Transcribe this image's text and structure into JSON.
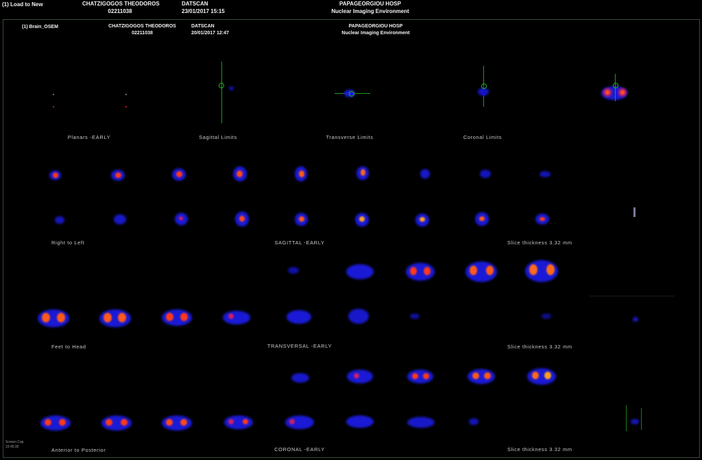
{
  "top_header": {
    "load_button": "(1) Load to New",
    "patient_name": "CHATZIGOGOS THEODOROS",
    "patient_id": "02211038",
    "study": "DATSCAN",
    "datetime": "23/01/2017 15:15",
    "hospital": "PAPAGEORGIOU HOSP",
    "environment": "Nuclear Imaging Environment"
  },
  "series_header": {
    "series_name": "(1) Brain_OSEM",
    "patient_name": "CHATZIGOGOS THEODOROS",
    "patient_id": "02211038",
    "study": "DATSCAN",
    "datetime": "20/01/2017 12:47",
    "hospital": "PAPAGEORGIOU HOSP",
    "environment": "Nuclear Imaging Environment"
  },
  "labels": {
    "planars": "Planars -EARLY",
    "sagittal_limits": "Sagittal Limits",
    "transverse_limits": "Transverse Limits",
    "coronal_limits": "Coronal Limits",
    "right_to_left": "Right to Left",
    "sagittal_early": "SAGITTAL -EARLY",
    "slice_thickness_1": "Slice thickness 3.32 mm",
    "feet_to_head": "Feet to Head",
    "transversal_early": "TRANSVERSAL -EARLY",
    "slice_thickness_2": "Slice thickness 3.32 mm",
    "anterior_to_posterior": "Anterior to Posterior",
    "coronal_early": "CORONAL -EARLY",
    "slice_thickness_3": "Slice thickness 3.32 mm"
  },
  "colors": {
    "low": "#1a1ad6",
    "mid": "#cc1f6a",
    "high": "#ff5a1a",
    "peak": "#ffd24a",
    "crosshair": "#1fb31f"
  },
  "footer": {
    "line1": "Screen Cap",
    "line2": "15:45:30"
  }
}
